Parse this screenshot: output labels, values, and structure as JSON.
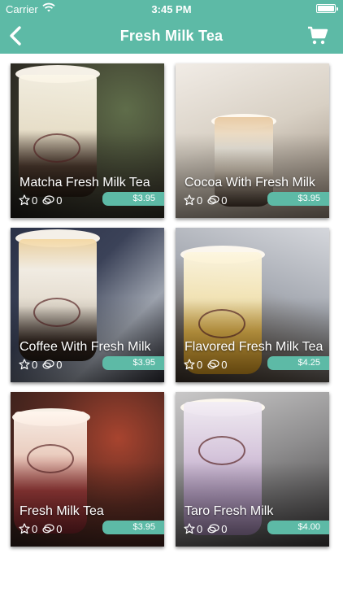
{
  "status": {
    "carrier": "Carrier",
    "time": "3:45 PM"
  },
  "nav": {
    "title": "Fresh Milk Tea"
  },
  "products": [
    {
      "name": "Matcha Fresh Milk Tea",
      "favorites": "0",
      "comments": "0",
      "price": "$3.95"
    },
    {
      "name": "Cocoa With Fresh Milk",
      "favorites": "0",
      "comments": "0",
      "price": "$3.95"
    },
    {
      "name": "Coffee With Fresh Milk",
      "favorites": "0",
      "comments": "0",
      "price": "$3.95"
    },
    {
      "name": "Flavored Fresh Milk Tea",
      "favorites": "0",
      "comments": "0",
      "price": "$4.25"
    },
    {
      "name": "Fresh Milk Tea",
      "favorites": "0",
      "comments": "0",
      "price": "$3.95"
    },
    {
      "name": "Taro Fresh Milk",
      "favorites": "0",
      "comments": "0",
      "price": "$4.00"
    }
  ],
  "colors": {
    "accent": "#5dbaa6"
  }
}
